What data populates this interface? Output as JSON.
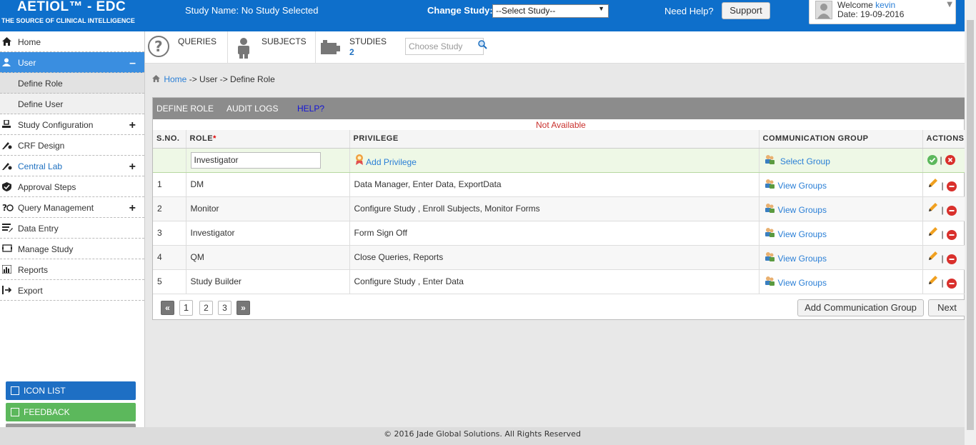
{
  "header": {
    "logo_title": "AETIOL™ - EDC",
    "logo_sub": "THE SOURCE OF CLINICAL INTELLIGENCE",
    "study_name": "Study Name: No Study Selected",
    "change_study_label": "Change Study:",
    "change_study_value": "--Select Study--",
    "need_help": "Need Help?",
    "support": "Support",
    "welcome": "Welcome",
    "user_name": "kevin",
    "date": "Date: 19-09-2016"
  },
  "sidebar": {
    "items": [
      {
        "label": "Home",
        "icon": "home-icon",
        "toggle": ""
      },
      {
        "label": "User",
        "icon": "user-icon",
        "toggle": "–"
      },
      {
        "label": "Define Role",
        "icon": "",
        "toggle": ""
      },
      {
        "label": "Define User",
        "icon": "",
        "toggle": ""
      },
      {
        "label": "Study Configuration",
        "icon": "study-config-icon",
        "toggle": "+"
      },
      {
        "label": "CRF Design",
        "icon": "crf-design-icon",
        "toggle": ""
      },
      {
        "label": "Central Lab",
        "icon": "central-lab-icon",
        "toggle": "+"
      },
      {
        "label": "Approval Steps",
        "icon": "approval-icon",
        "toggle": ""
      },
      {
        "label": "Query Management",
        "icon": "query-icon",
        "toggle": "+"
      },
      {
        "label": "Data Entry",
        "icon": "data-entry-icon",
        "toggle": ""
      },
      {
        "label": "Manage Study",
        "icon": "manage-study-icon",
        "toggle": ""
      },
      {
        "label": "Reports",
        "icon": "reports-icon",
        "toggle": ""
      },
      {
        "label": "Export",
        "icon": "export-icon",
        "toggle": ""
      }
    ],
    "icon_list": "ICON LIST",
    "feedback": "FEEDBACK"
  },
  "topnav": {
    "queries": "QUERIES",
    "subjects": "SUBJECTS",
    "studies": "STUDIES",
    "studies_count": "2",
    "choose_study_placeholder": "Choose Study"
  },
  "breadcrumb": {
    "home": "Home",
    "rest": " -> User -> Define Role"
  },
  "panel": {
    "tabs": [
      "DEFINE ROLE",
      "AUDIT LOGS",
      "HELP?"
    ],
    "status": "Not Available",
    "columns": [
      "S.NO.",
      "ROLE",
      "PRIVILEGE",
      "COMMUNICATION GROUP",
      "ACTIONS"
    ],
    "role_required_mark": "*",
    "edit_row": {
      "role_value": "Investigator",
      "add_privilege": "Add Privilege",
      "select_group": "Select Group"
    },
    "rows": [
      {
        "sno": "1",
        "role": "DM",
        "privilege": "Data Manager, Enter Data, ExportData",
        "group": "View Groups"
      },
      {
        "sno": "2",
        "role": "Monitor",
        "privilege": "Configure Study , Enroll Subjects, Monitor Forms",
        "group": "View Groups"
      },
      {
        "sno": "3",
        "role": "Investigator",
        "privilege": "Form Sign Off",
        "group": "View Groups"
      },
      {
        "sno": "4",
        "role": "QM",
        "privilege": "Close Queries, Reports",
        "group": "View Groups"
      },
      {
        "sno": "5",
        "role": "Study Builder",
        "privilege": "Configure Study , Enter Data",
        "group": "View Groups"
      }
    ],
    "pager": {
      "prev": "«",
      "pages": [
        "1",
        "2",
        "3"
      ],
      "next": "»"
    },
    "add_comm_group": "Add Communication Group",
    "next_button": "Next"
  },
  "footer": "© 2016 Jade Global Solutions. All Rights Reserved",
  "colors": {
    "brand": "#0e6fcb",
    "active_nav": "#3a8ee0",
    "link": "#2a7fd6",
    "icon_list": "#1e6fc4",
    "feedback": "#5cb85c"
  }
}
